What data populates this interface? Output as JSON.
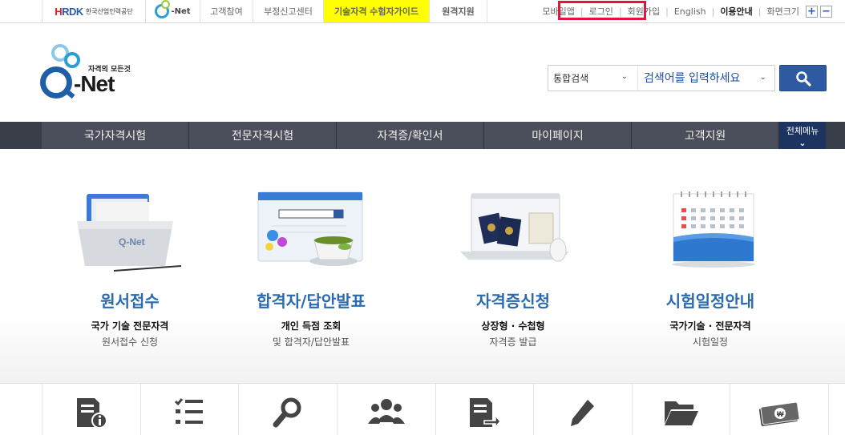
{
  "topbar": {
    "hrdk_logo": "HRDK",
    "hrdk_name": "한국산업인력공단",
    "qnet_small": "Q-Net",
    "links": {
      "customer": "고객참여",
      "report": "부정신고센터",
      "guide": "기술자격 수험자가이드",
      "remote": "원격지원"
    },
    "right": {
      "mobile": "모바일앱",
      "login": "로그인",
      "join": "회원가입",
      "english": "English",
      "guide": "이용안내",
      "fontsize": "화면크기",
      "zoom_in": "+",
      "zoom_out": "−"
    }
  },
  "brand": {
    "slogan": "자격의 모든것",
    "name": "-Net"
  },
  "search": {
    "scope": "통합검색",
    "placeholder": "검색어를 입력하세요"
  },
  "gnb": {
    "items": [
      "국가자격시험",
      "전문자격시험",
      "자격증/확인서",
      "마이페이지",
      "고객지원"
    ],
    "all_menu": "전체메뉴"
  },
  "cards": [
    {
      "title": "원서접수",
      "sub1": "국가 기술 전문자격",
      "sub2": "원서접수 신청",
      "icon": "folder-illustration"
    },
    {
      "title": "합격자/답안발표",
      "sub1": "개인 득점 조회",
      "sub2": "및 합격자/답안발표",
      "icon": "browser-balloon-cup-illustration"
    },
    {
      "title": "자격증신청",
      "sub1": "상장형 · 수첩형",
      "sub2": "자격증 발급",
      "icon": "laptop-passport-illustration"
    },
    {
      "title": "시험일정안내",
      "sub1": "국가기술 · 전문자격",
      "sub2": "시험일정",
      "icon": "calendar-illustration"
    }
  ],
  "quick_icons": [
    "document-info-icon",
    "checklist-icon",
    "magnifier-icon",
    "group-icon",
    "document-return-icon",
    "pencil-icon",
    "folder-open-icon",
    "money-icon"
  ],
  "colors": {
    "accent": "#2a6ab0",
    "gnb_bg": "#4a4e5a",
    "all_menu_bg": "#1d3461",
    "search_btn": "#2d5aa0",
    "guide_bg": "#ffff00",
    "guide_text": "#d9252a",
    "highlight": "#e0163e"
  }
}
